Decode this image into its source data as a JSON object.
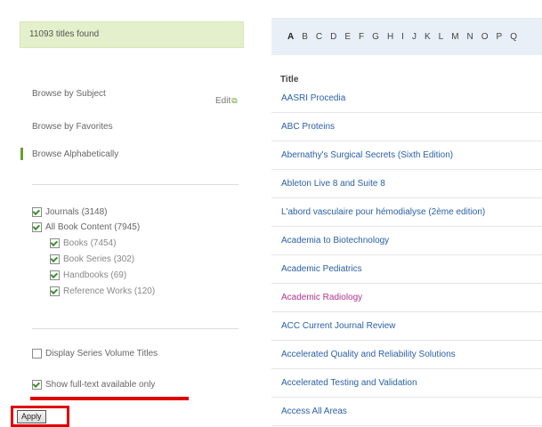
{
  "summary": {
    "found_text": "11093 titles found"
  },
  "browse": {
    "by_subject": "Browse by Subject",
    "edit_label": "Edit",
    "by_favorites": "Browse by Favorites",
    "alphabetically": "Browse Alphabetically"
  },
  "filters": {
    "journals": "Journals (3148)",
    "all_books": "All Book Content (7945)",
    "books": "Books (7454)",
    "book_series": "Book Series (302)",
    "handbooks": "Handbooks (69)",
    "reference_works": "Reference Works (120)"
  },
  "options": {
    "display_series": "Display Series Volume Titles",
    "full_text": "Show full-text available only"
  },
  "apply_label": "Apply",
  "alphabet": [
    "A",
    "B",
    "C",
    "D",
    "E",
    "F",
    "G",
    "H",
    "I",
    "J",
    "K",
    "L",
    "M",
    "N",
    "O",
    "P",
    "Q"
  ],
  "title_header": "Title",
  "titles": [
    "AASRI Procedia",
    "ABC Proteins",
    "Abernathy's Surgical Secrets (Sixth Edition)",
    "Ableton Live 8 and Suite 8",
    "L'abord vasculaire pour hémodialyse (2ème edition)",
    "Academia to Biotechnology",
    "Academic Pediatrics",
    "Academic Radiology",
    "ACC Current Journal Review",
    "Accelerated Quality and Reliability Solutions",
    "Accelerated Testing and Validation",
    "Access All Areas"
  ]
}
